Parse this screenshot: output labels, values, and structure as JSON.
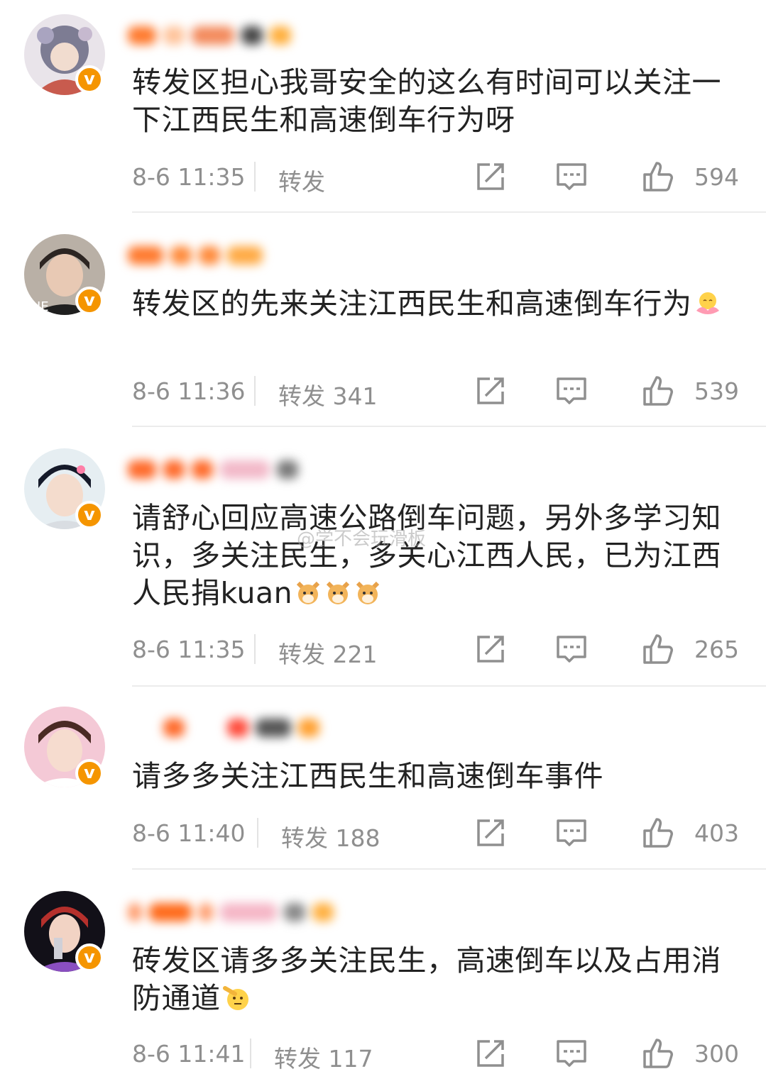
{
  "comments": [
    {
      "text": "转发区担心我哥安全的这么有时间可以关注一下江西民生和高速倒车行为呀",
      "time": "8-6 11:35",
      "repost": "转发",
      "likes": "594"
    },
    {
      "text": "转发区的先来关注江西民生和高速倒车行为",
      "time": "8-6 11:36",
      "repost": "转发 341",
      "likes": "539"
    },
    {
      "text": "请舒心回应高速公路倒车问题，另外多学习知识，多关注民生，多关心江西人民，已为江西人民捐kuan",
      "time": "8-6 11:35",
      "repost": "转发 221",
      "likes": "265"
    },
    {
      "text": "请多多关注江西民生和高速倒车事件",
      "time": "8-6 11:40",
      "repost": "转发 188",
      "likes": "403"
    },
    {
      "text": "砖发区请多多关注民生，高速倒车以及占用消防通道",
      "time": "8-6 11:41",
      "repost": "转发 117",
      "likes": "300"
    }
  ],
  "watermark": "@学不会玩滑板",
  "colors": {
    "accent": "#f59500",
    "meta": "#8f8f8f",
    "text": "#222222"
  }
}
